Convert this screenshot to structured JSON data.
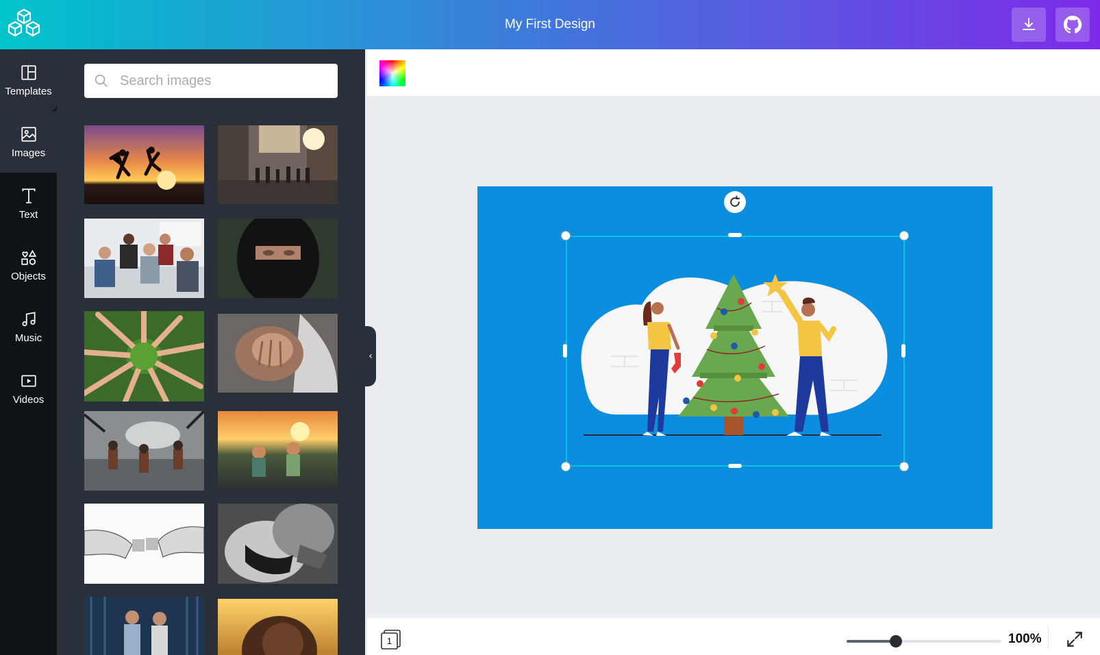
{
  "header": {
    "title": "My First Design",
    "download_icon": "download-icon",
    "github_icon": "github-icon",
    "logo": "cubes-logo"
  },
  "sidebar": {
    "items": [
      {
        "label": "Templates",
        "icon": "layout-icon"
      },
      {
        "label": "Images",
        "icon": "image-icon",
        "active": true
      },
      {
        "label": "Text",
        "icon": "text-icon"
      },
      {
        "label": "Objects",
        "icon": "shapes-icon"
      },
      {
        "label": "Music",
        "icon": "music-icon"
      },
      {
        "label": "Videos",
        "icon": "video-icon"
      }
    ]
  },
  "image_panel": {
    "search": {
      "placeholder": "Search images",
      "value": ""
    },
    "thumbnails": [
      "sunset-jumping-silhouettes",
      "city-street-crowd",
      "office-meeting",
      "woman-niqab",
      "hands-circle-grass",
      "hands-together",
      "children-playing-water",
      "children-sunset-field",
      "hands-puzzle-pieces",
      "couple-black-white",
      "children-forest",
      "girl-golden-field"
    ]
  },
  "canvas": {
    "background_color": "#0b8ee0",
    "selected_element": "christmas-tree-illustration"
  },
  "bottom_bar": {
    "page_count": "1",
    "zoom_label": "100%",
    "zoom_fraction": 0.32
  },
  "colors": {
    "accent": "#00c4e0",
    "panel": "#293039",
    "rail": "#0e1318"
  }
}
